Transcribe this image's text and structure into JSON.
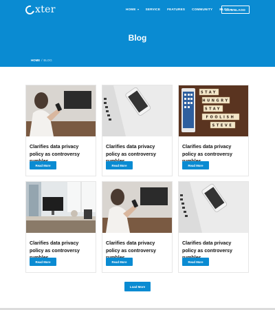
{
  "brand": {
    "name": "xter"
  },
  "nav": {
    "items": [
      {
        "label": "HOME",
        "dropdown": true
      },
      {
        "label": "SERVICE",
        "dropdown": false
      },
      {
        "label": "FEATURES",
        "dropdown": false
      },
      {
        "label": "COMMUNITY",
        "dropdown": false
      },
      {
        "label": "BLOG",
        "dropdown": true
      }
    ],
    "download_label": "DOWNLAOD"
  },
  "page": {
    "title": "Blog",
    "breadcrumb": {
      "home": "HOME",
      "separator": "/",
      "current": "BLOG"
    }
  },
  "posts": [
    {
      "title": "Clarifies data privacy policy as controversy rumbles",
      "button": "Read More",
      "image": "woman-with-phone"
    },
    {
      "title": "Clarifies data privacy policy as controversy rumbles",
      "button": "Read More",
      "image": "phone-on-laptop"
    },
    {
      "title": "Clarifies data privacy policy as controversy rumbles",
      "button": "Read More",
      "image": "scrabble-tiles-phone"
    },
    {
      "title": "Clarifies data privacy policy as controversy rumbles",
      "button": "Read More",
      "image": "office-desk"
    },
    {
      "title": "Clarifies data privacy policy as controversy rumbles",
      "button": "Read More",
      "image": "woman-with-phone"
    },
    {
      "title": "Clarifies data privacy policy as controversy rumbles",
      "button": "Read More",
      "image": "phone-on-laptop"
    }
  ],
  "tiles": {
    "row1": "STAY",
    "row2": "HUNGRY",
    "row3": "STAY",
    "row4": "FOOLISH",
    "row5": "STEVE"
  },
  "load_more_label": "Load More",
  "colors": {
    "primary": "#0a8bd2",
    "text": "#111111",
    "border": "#e6e6e6"
  }
}
